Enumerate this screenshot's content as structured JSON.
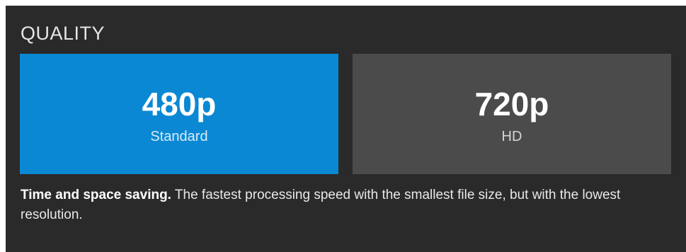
{
  "quality": {
    "title": "QUALITY",
    "selected_color": "#0a88d4",
    "unselected_color": "#4b4b4b",
    "options": [
      {
        "resolution": "480p",
        "label": "Standard",
        "selected": true
      },
      {
        "resolution": "720p",
        "label": "HD",
        "selected": false
      }
    ],
    "description": {
      "headline": "Time and space saving.",
      "body": " The fastest processing speed with the smallest file size, but with the lowest resolution."
    }
  }
}
